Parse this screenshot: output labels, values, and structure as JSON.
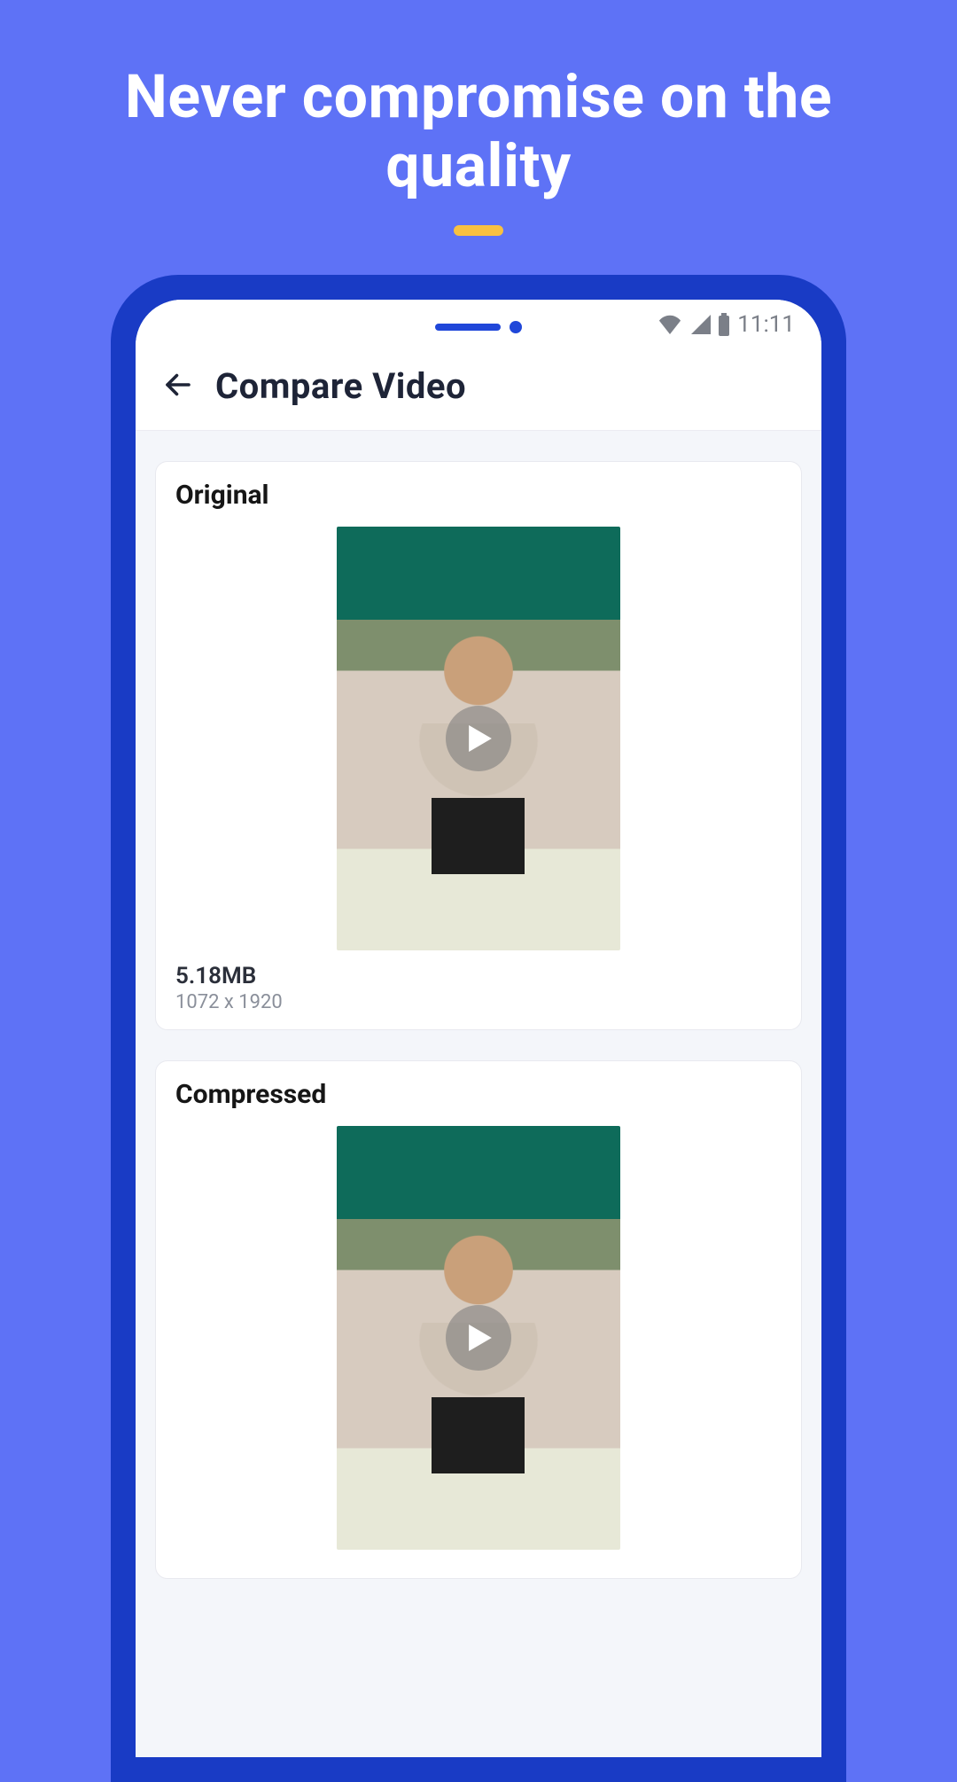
{
  "promo": {
    "heading": "Never compromise on the quality"
  },
  "status": {
    "time": "11:11"
  },
  "header": {
    "title": "Compare Video"
  },
  "cards": {
    "original": {
      "title": "Original",
      "size": "5.18MB",
      "dimensions": "1072 x 1920"
    },
    "compressed": {
      "title": "Compressed"
    }
  }
}
